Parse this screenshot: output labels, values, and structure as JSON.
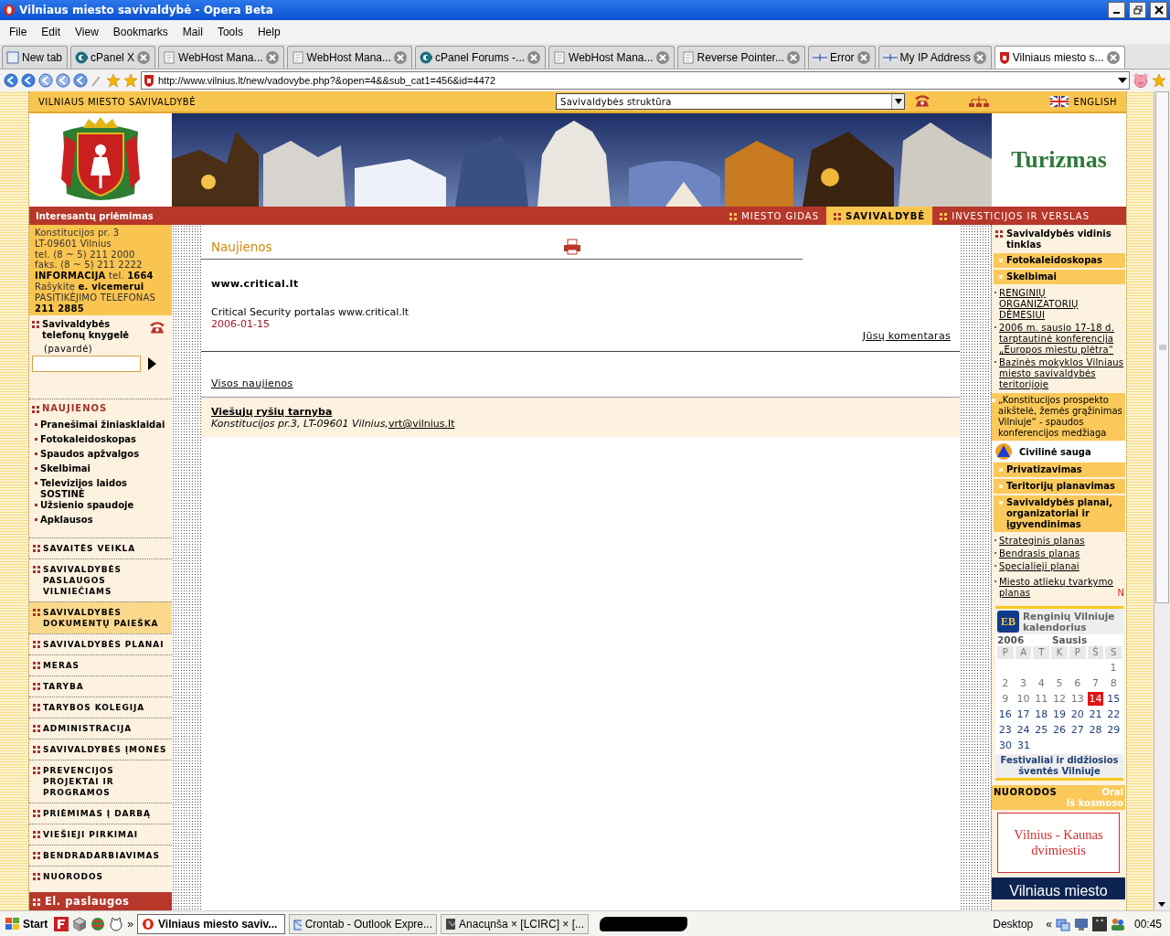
{
  "window": {
    "title": "Vilniaus miesto savivaldybė - Opera Beta"
  },
  "menu": [
    "File",
    "Edit",
    "View",
    "Bookmarks",
    "Mail",
    "Tools",
    "Help"
  ],
  "tabs": [
    {
      "label": "New tab",
      "selected": false,
      "kind": "new"
    },
    {
      "label": "cPanel X",
      "selected": false,
      "kind": "cpanel"
    },
    {
      "label": "WebHost Mana...",
      "selected": false,
      "kind": "page"
    },
    {
      "label": "WebHost Mana...",
      "selected": false,
      "kind": "page"
    },
    {
      "label": "cPanel Forums -...",
      "selected": false,
      "kind": "cpanel"
    },
    {
      "label": "WebHost Mana...",
      "selected": false,
      "kind": "page"
    },
    {
      "label": "Reverse Pointer...",
      "selected": false,
      "kind": "page"
    },
    {
      "label": "Error",
      "selected": false,
      "kind": "dns"
    },
    {
      "label": "My IP Address",
      "selected": false,
      "kind": "dns"
    },
    {
      "label": "Vilniaus miesto s...",
      "selected": true,
      "kind": "site"
    }
  ],
  "address": "http://www.vilnius.lt/new/vadovybe.php?&open=4&&sub_cat1=456&id=4472",
  "page": {
    "top_strip": {
      "site_name": "VILNIAUS MIESTO SAVIVALDYBĖ",
      "section_select": "Savivaldybės struktūra",
      "language": "ENGLISH"
    },
    "header": {
      "side_link": "Turizmas"
    },
    "nav": {
      "reception": "Interesantų priėmimas",
      "tabs": [
        {
          "label": "MIESTO GIDAS",
          "selected": false
        },
        {
          "label": "SAVIVALDYBĖ",
          "selected": true
        },
        {
          "label": "INVESTICIJOS IR VERSLAS",
          "selected": false
        }
      ]
    },
    "left": {
      "contact": [
        "Konstitucijos pr. 3",
        "LT-09601 Vilnius",
        "tel. (8 ~ 5) 211 2000",
        "faks. (8 ~ 5) 211 2222",
        "**INFORMACIJA** tel. **1664**",
        "Rašykite **e. vicemerui**",
        "PASITIKĖJIMO TELEFONAS",
        "**211 2885**"
      ],
      "phonebook": {
        "title": "Savivaldybės telefonų knygelė",
        "field_label": "(pavardė)"
      },
      "news": {
        "title": "NAUJIENOS",
        "items": [
          "Pranešimai žiniasklaidai",
          "Fotokaleidoskopas",
          "Spaudos apžvalgos",
          "Skelbimai",
          "Televizijos laidos SOSTINĖ",
          "Užsienio spaudoje",
          "Apklausos"
        ]
      },
      "menu": [
        {
          "label": "SAVAITĖS VEIKLA",
          "highlighted": false
        },
        {
          "label": "SAVIVALDYBĖS PASLAUGOS VILNIEČIAMS",
          "highlighted": false
        },
        {
          "label": "SAVIVALDYBĖS DOKUMENTŲ PAIEŠKA",
          "highlighted": true
        },
        {
          "label": "SAVIVALDYBĖS PLANAI",
          "highlighted": false
        },
        {
          "label": "MERAS",
          "highlighted": false
        },
        {
          "label": "TARYBA",
          "highlighted": false
        },
        {
          "label": "TARYBOS KOLEGIJA",
          "highlighted": false
        },
        {
          "label": "ADMINISTRACIJA",
          "highlighted": false
        },
        {
          "label": "SAVIVALDYBĖS ĮMONĖS",
          "highlighted": false
        },
        {
          "label": "PREVENCIJOS PROJEKTAI IR PROGRAMOS",
          "highlighted": false
        },
        {
          "label": "PRIĖMIMAS Į DARBĄ",
          "highlighted": false
        },
        {
          "label": "VIEŠIEJI PIRKIMAI",
          "highlighted": false
        },
        {
          "label": "BENDRADARBIAVIMAS",
          "highlighted": false
        },
        {
          "label": "NUORODOS",
          "highlighted": false
        }
      ],
      "eservices": "El. paslaugos"
    },
    "content": {
      "title": "Naujienos",
      "article": {
        "title": "www.critical.lt",
        "text": "Critical Security portalas www.critical.lt",
        "date": "2006-01-15"
      },
      "comment_link": "Jūsų komentaras",
      "all_link": "Visos naujienos",
      "footer": {
        "office": "Viešųjų ryšių tarnyba",
        "address": "Konstitucijos pr.3, LT-09601 Vilnius,",
        "email": "vrt@vilnius.lt"
      }
    },
    "right": {
      "blocks": [
        {
          "kind": "heading",
          "text": "Savivaldybės vidinis tinklas"
        },
        {
          "kind": "bar",
          "text": "Fotokaleidoskopas"
        },
        {
          "kind": "bar",
          "text": "Skelbimai"
        },
        {
          "kind": "links",
          "items": [
            {
              "text": "RENGINIŲ ORGANIZATORIŲ DĖMESIUI"
            },
            {
              "text": "2006 m. sausio 17-18 d. tarptautinė konferencija „Europos miestų plėtra“"
            },
            {
              "text": "Bazinės mokyklos Vilniaus miesto savivaldybės teritorijoje"
            }
          ]
        },
        {
          "kind": "note",
          "text": "„Konstitucijos prospekto aikštelė, žemės grąžinimas Vilniuje“ - spaudos konferencijos medžiaga"
        },
        {
          "kind": "alert",
          "text": "Civilinė sauga"
        },
        {
          "kind": "bar",
          "text": "Privatizavimas"
        },
        {
          "kind": "bar",
          "text": "Teritorijų planavimas"
        },
        {
          "kind": "bar",
          "text": "Savivaldybės planai, organizatoriai ir įgyvendinimas"
        },
        {
          "kind": "links",
          "items": [
            {
              "text": "Strateginis planas"
            },
            {
              "text": "Bendrasis planas"
            },
            {
              "text": "Specialieji planai"
            }
          ]
        },
        {
          "kind": "links",
          "items": [
            {
              "text": "Miesto atliekų tvarkymo planas",
              "badge": "N"
            }
          ]
        }
      ],
      "calendar": {
        "logo": "EB",
        "title": "Renginių Vilniuje kalendorius",
        "year": "2006",
        "month": "Sausis",
        "weekdays": [
          "P",
          "A",
          "T",
          "K",
          "P",
          "Š",
          "S"
        ],
        "weeks": [
          {
            "starts_mid_week": true,
            "days": [
              {
                "d": "1",
                "past": true,
                "today": false
              }
            ]
          },
          {
            "days": [
              {
                "d": "2",
                "past": true,
                "today": false
              },
              {
                "d": "3",
                "past": true,
                "today": false
              },
              {
                "d": "4",
                "past": true,
                "today": false
              },
              {
                "d": "5",
                "past": true,
                "today": false
              },
              {
                "d": "6",
                "past": true,
                "today": false
              },
              {
                "d": "7",
                "past": true,
                "today": false
              },
              {
                "d": "8",
                "past": true,
                "today": false
              }
            ]
          },
          {
            "days": [
              {
                "d": "9",
                "past": true,
                "today": false
              },
              {
                "d": "10",
                "past": true,
                "today": false
              },
              {
                "d": "11",
                "past": true,
                "today": false
              },
              {
                "d": "12",
                "past": true,
                "today": false
              },
              {
                "d": "13",
                "past": true,
                "today": false
              },
              {
                "d": "14",
                "past": false,
                "today": true
              },
              {
                "d": "15",
                "past": false,
                "today": false
              }
            ]
          },
          {
            "days": [
              {
                "d": "16",
                "past": false,
                "today": false
              },
              {
                "d": "17",
                "past": false,
                "today": false
              },
              {
                "d": "18",
                "past": false,
                "today": false
              },
              {
                "d": "19",
                "past": false,
                "today": false
              },
              {
                "d": "20",
                "past": false,
                "today": false
              },
              {
                "d": "21",
                "past": false,
                "today": false
              },
              {
                "d": "22",
                "past": false,
                "today": false
              }
            ]
          },
          {
            "days": [
              {
                "d": "23",
                "past": false,
                "today": false
              },
              {
                "d": "24",
                "past": false,
                "today": false
              },
              {
                "d": "25",
                "past": false,
                "today": false
              },
              {
                "d": "26",
                "past": false,
                "today": false
              },
              {
                "d": "27",
                "past": false,
                "today": false
              },
              {
                "d": "28",
                "past": false,
                "today": false
              },
              {
                "d": "29",
                "past": false,
                "today": false
              }
            ]
          },
          {
            "days": [
              {
                "d": "30",
                "past": false,
                "today": false
              },
              {
                "d": "31",
                "past": false,
                "today": false
              }
            ]
          }
        ],
        "footer": "Festivaliai ir didžiosios šventės Vilniuje"
      },
      "links_header": {
        "title": "NUORODOS",
        "weather": "Orai",
        "space": "Iš kosmoso"
      },
      "banners": [
        {
          "kind": "light",
          "text": "Vilnius - Kaunas dvimiestis"
        },
        {
          "kind": "dark",
          "text": "Vilniaus miesto"
        }
      ]
    }
  },
  "taskbar": {
    "start": "Start",
    "launch_more": "»",
    "tasks": [
      {
        "label": "Vilniaus miesto saviv...",
        "selected": true,
        "kind": "opera"
      },
      {
        "label": "Crontab - Outlook Expre...",
        "selected": false,
        "kind": "mail"
      },
      {
        "label": "Anacцnša × [LCIRC] × [...",
        "selected": false,
        "kind": "chat"
      },
      {
        "kind": "redacted",
        "selected": false
      }
    ],
    "desktop": "Desktop",
    "tray_more": "«",
    "clock": "00:45"
  }
}
